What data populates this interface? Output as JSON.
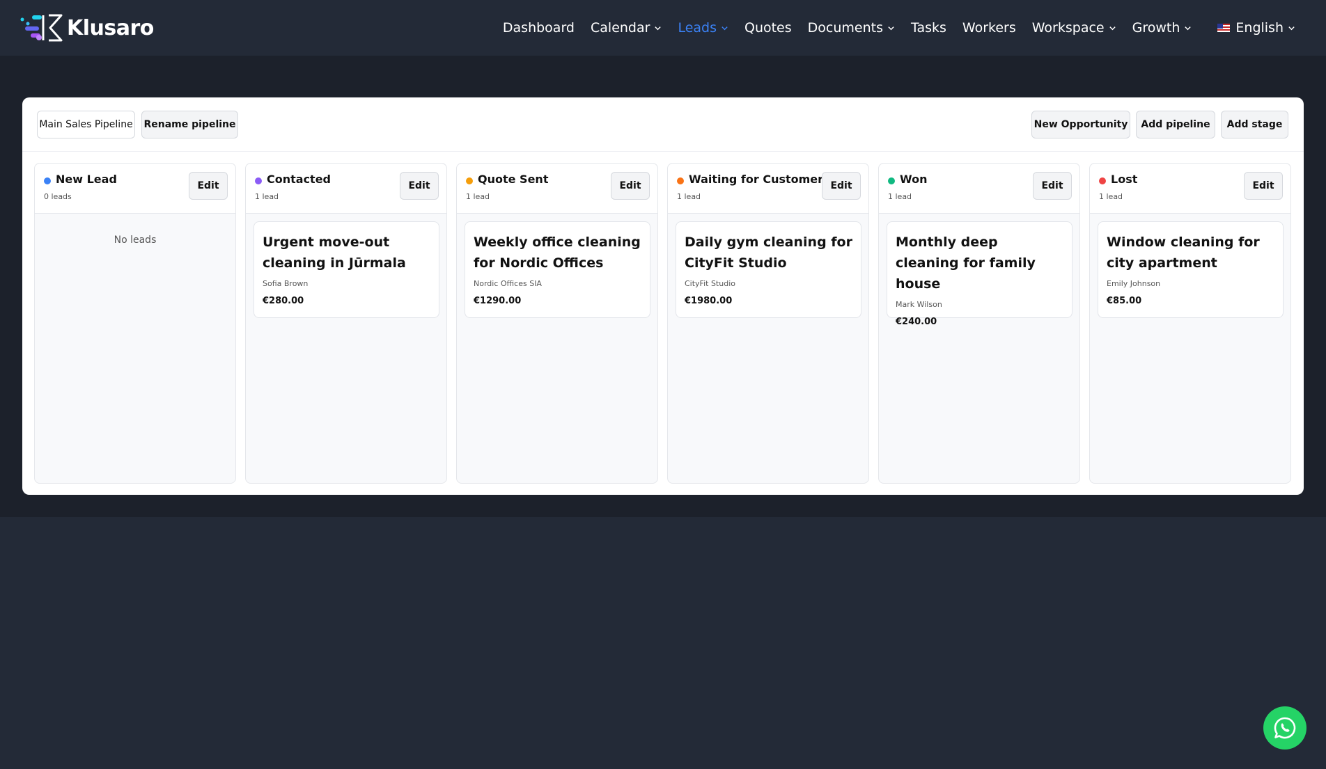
{
  "brand": {
    "name": "Klusaro"
  },
  "nav": {
    "dashboard": "Dashboard",
    "calendar": "Calendar",
    "leads": "Leads",
    "quotes": "Quotes",
    "documents": "Documents",
    "tasks": "Tasks",
    "workers": "Workers",
    "workspace": "Workspace",
    "growth": "Growth",
    "language": "English",
    "active_color": "#3b82f6"
  },
  "toolbar": {
    "pipeline_select": "Main Sales Pipeline",
    "rename_pipeline": "Rename pipeline",
    "new_opportunity": "New Opportunity",
    "add_pipeline": "Add pipeline",
    "add_stage": "Add stage"
  },
  "stages": [
    {
      "title": "New Lead",
      "count": "0 leads",
      "color": "#3b82f6",
      "edit": "Edit",
      "empty": "No leads"
    },
    {
      "title": "Contacted",
      "count": "1 lead",
      "color": "#8b5cf6",
      "edit": "Edit",
      "card": {
        "title": "Urgent move-out cleaning in Jūrmala",
        "client": "Sofia Brown",
        "amount": "€280.00"
      }
    },
    {
      "title": "Quote Sent",
      "count": "1 lead",
      "color": "#f59e0b",
      "edit": "Edit",
      "card": {
        "title": "Weekly office cleaning for Nordic Offices",
        "client": "Nordic Offices SIA",
        "amount": "€1290.00"
      }
    },
    {
      "title": "Waiting for Customer",
      "count": "1 lead",
      "color": "#f97316",
      "edit": "Edit",
      "card": {
        "title": "Daily gym cleaning for CityFit Studio",
        "client": "CityFit Studio",
        "amount": "€1980.00"
      }
    },
    {
      "title": "Won",
      "count": "1 lead",
      "color": "#10b981",
      "edit": "Edit",
      "card": {
        "title": "Monthly deep cleaning for family house",
        "client": "Mark Wilson",
        "amount": "€240.00"
      }
    },
    {
      "title": "Lost",
      "count": "1 lead",
      "color": "#ef4444",
      "edit": "Edit",
      "card": {
        "title": "Window cleaning for city apartment",
        "client": "Emily Johnson",
        "amount": "€85.00"
      }
    }
  ],
  "icons": {
    "chat": "whatsapp-icon"
  }
}
